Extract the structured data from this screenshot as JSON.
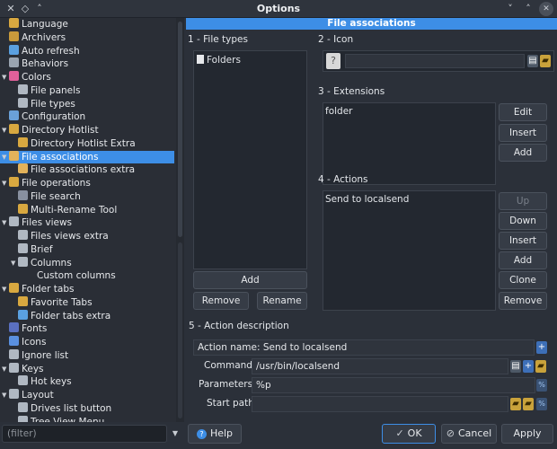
{
  "window": {
    "title": "Options"
  },
  "tree": [
    {
      "label": "Language",
      "level": 1,
      "arrow": "",
      "icon": "#d8a840"
    },
    {
      "label": "Archivers",
      "level": 1,
      "arrow": "",
      "icon": "#c99a3b"
    },
    {
      "label": "Auto refresh",
      "level": 1,
      "arrow": "",
      "icon": "#5aa0e0"
    },
    {
      "label": "Behaviors",
      "level": 1,
      "arrow": "",
      "icon": "#9aa4b0"
    },
    {
      "label": "Colors",
      "level": 1,
      "arrow": "down",
      "icon": "#e0609a"
    },
    {
      "label": "File panels",
      "level": 2,
      "arrow": "",
      "icon": "#b0b8c2"
    },
    {
      "label": "File types",
      "level": 2,
      "arrow": "",
      "icon": "#b0b8c2"
    },
    {
      "label": "Configuration",
      "level": 1,
      "arrow": "",
      "icon": "#6aa0d8"
    },
    {
      "label": "Directory Hotlist",
      "level": 1,
      "arrow": "down",
      "icon": "#d8a840"
    },
    {
      "label": "Directory Hotlist Extra",
      "level": 2,
      "arrow": "",
      "icon": "#d8a840"
    },
    {
      "label": "File associations",
      "level": 1,
      "arrow": "down",
      "icon": "#e2b25a",
      "selected": true
    },
    {
      "label": "File associations extra",
      "level": 2,
      "arrow": "",
      "icon": "#e2b25a"
    },
    {
      "label": "File operations",
      "level": 1,
      "arrow": "down",
      "icon": "#d8a840"
    },
    {
      "label": "File search",
      "level": 2,
      "arrow": "",
      "icon": "#8890a0"
    },
    {
      "label": "Multi-Rename Tool",
      "level": 2,
      "arrow": "",
      "icon": "#d8a840"
    },
    {
      "label": "Files views",
      "level": 1,
      "arrow": "down",
      "icon": "#b0b8c2"
    },
    {
      "label": "Files views extra",
      "level": 2,
      "arrow": "",
      "icon": "#b0b8c2"
    },
    {
      "label": "Brief",
      "level": 2,
      "arrow": "",
      "icon": "#b0b8c2"
    },
    {
      "label": "Columns",
      "level": 2,
      "arrow": "down",
      "icon": "#b0b8c2"
    },
    {
      "label": "Custom columns",
      "level": 3,
      "arrow": "",
      "icon": ""
    },
    {
      "label": "Folder tabs",
      "level": 1,
      "arrow": "down",
      "icon": "#d8a840"
    },
    {
      "label": "Favorite Tabs",
      "level": 2,
      "arrow": "",
      "icon": "#d8a840"
    },
    {
      "label": "Folder tabs extra",
      "level": 2,
      "arrow": "",
      "icon": "#5aa0e0"
    },
    {
      "label": "Fonts",
      "level": 1,
      "arrow": "",
      "icon": "#5a70c0"
    },
    {
      "label": "Icons",
      "level": 1,
      "arrow": "",
      "icon": "#5a90e0"
    },
    {
      "label": "Ignore list",
      "level": 1,
      "arrow": "",
      "icon": "#b0b8c2"
    },
    {
      "label": "Keys",
      "level": 1,
      "arrow": "down",
      "icon": "#b0b8c2"
    },
    {
      "label": "Hot keys",
      "level": 2,
      "arrow": "",
      "icon": "#b0b8c2"
    },
    {
      "label": "Layout",
      "level": 1,
      "arrow": "down",
      "icon": "#b0b8c2"
    },
    {
      "label": "Drives list button",
      "level": 2,
      "arrow": "",
      "icon": "#b0b8c2"
    },
    {
      "label": "Tree View Menu",
      "level": 2,
      "arrow": "",
      "icon": "#b0b8c2"
    }
  ],
  "filter": {
    "placeholder": "(filter)"
  },
  "panel": {
    "header": "File associations",
    "file_types_label": "1 - File types",
    "file_types": [
      "Folders"
    ],
    "add": "Add",
    "remove": "Remove",
    "rename": "Rename",
    "icon_label": "2 - Icon",
    "icon_path": "",
    "extensions_label": "3 - Extensions",
    "extensions": [
      "folder"
    ],
    "edit": "Edit",
    "insert": "Insert",
    "add_ext": "Add",
    "actions_label": "4 - Actions",
    "actions": [
      "Send to localsend"
    ],
    "up": "Up",
    "down": "Down",
    "insert_act": "Insert",
    "add_act": "Add",
    "clone": "Clone",
    "remove_act": "Remove",
    "desc_label": "5 - Action description",
    "action_name_label": "Action name:",
    "action_name": "Send to localsend",
    "command_label": "Command:",
    "command": "/usr/bin/localsend",
    "parameters_label": "Parameters:",
    "parameters": "%p",
    "start_path_label": "Start path:",
    "start_path": ""
  },
  "footer": {
    "help": "Help",
    "ok": "OK",
    "cancel": "Cancel",
    "apply": "Apply"
  }
}
